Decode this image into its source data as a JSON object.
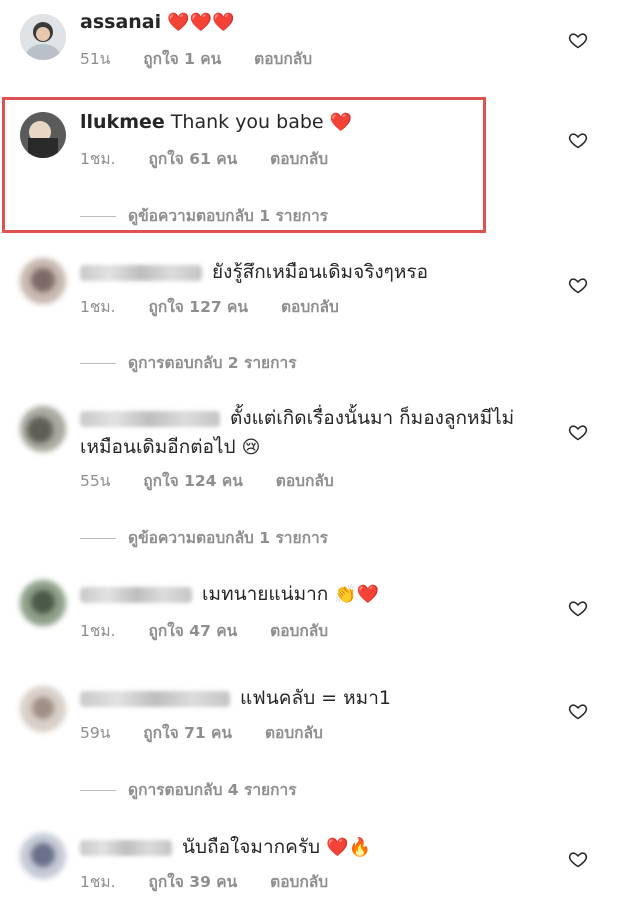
{
  "comments": [
    {
      "username": "assanai",
      "text": "",
      "emojis": "❤️❤️❤️",
      "time": "51น",
      "likes": "ถูกใจ 1 คน",
      "reply_label": "ตอบกลับ",
      "replies_label": ""
    },
    {
      "username": "llukmee",
      "text": "Thank you babe",
      "emojis": "❤️",
      "time": "1ชม.",
      "likes": "ถูกใจ 61 คน",
      "reply_label": "ตอบกลับ",
      "replies_label": "ดูข้อความตอบกลับ 1 รายการ"
    },
    {
      "username": "",
      "text": "ยังรู้สึกเหมือนเดิมจริงๆหรอ",
      "emojis": "",
      "time": "1ชม.",
      "likes": "ถูกใจ 127 คน",
      "reply_label": "ตอบกลับ",
      "replies_label": "ดูการตอบกลับ 2 รายการ"
    },
    {
      "username": "",
      "text": "ตั้งแต่เกิดเรื่องนั้นมา ก็มองลูกหมีไม่",
      "text2": "เหมือนเดิมอีกต่อไป",
      "emojis": "😢",
      "time": "55น",
      "likes": "ถูกใจ 124 คน",
      "reply_label": "ตอบกลับ",
      "replies_label": "ดูข้อความตอบกลับ 1 รายการ"
    },
    {
      "username": "",
      "text": "เมทนายแน่มาก",
      "emojis": "👏❤️",
      "time": "1ชม.",
      "likes": "ถูกใจ 47 คน",
      "reply_label": "ตอบกลับ",
      "replies_label": ""
    },
    {
      "username": "",
      "text": "แฟนคลับ = หมา1",
      "emojis": "",
      "time": "59น",
      "likes": "ถูกใจ 71 คน",
      "reply_label": "ตอบกลับ",
      "replies_label": "ดูการตอบกลับ 4 รายการ"
    },
    {
      "username": "",
      "text": "นับถือใจมากครับ",
      "emojis": "❤️🔥",
      "time": "1ชม.",
      "likes": "ถูกใจ 39 คน",
      "reply_label": "ตอบกลับ",
      "replies_label": ""
    }
  ],
  "icons": {
    "like": "heart-outline-icon"
  },
  "colors": {
    "highlight": "#e05151",
    "muted": "#8e8e8e",
    "heart": "#ed4956"
  }
}
